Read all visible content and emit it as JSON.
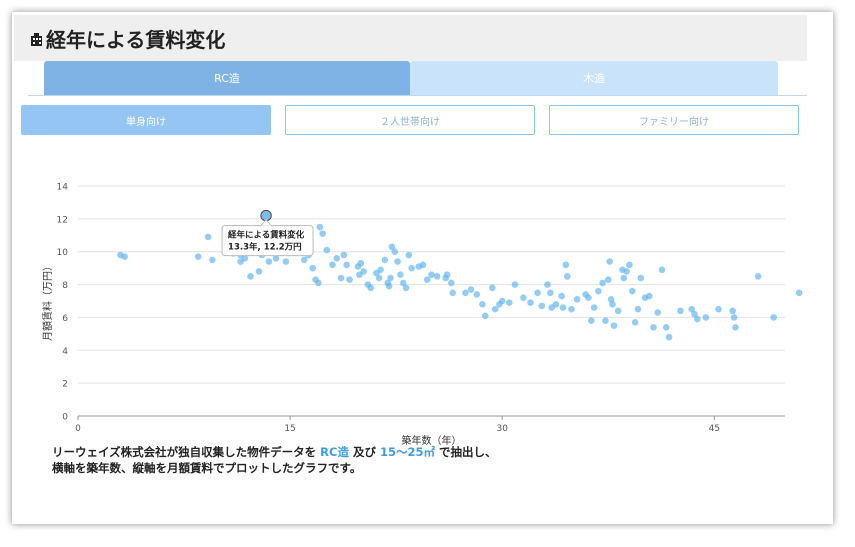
{
  "header": {
    "title": "経年による賃料変化",
    "icon": "building-icon"
  },
  "tabs": [
    {
      "label": "RC造",
      "active": true
    },
    {
      "label": "木造",
      "active": false
    }
  ],
  "segments": [
    {
      "label": "単身向け",
      "active": true
    },
    {
      "label": "２人世帯向け",
      "active": false
    },
    {
      "label": "ファミリー向け",
      "active": false
    }
  ],
  "tooltip": {
    "title": "経年による賃料変化",
    "value": "13.3年, 12.2万円"
  },
  "note": {
    "line1_a": "リーウェイズ株式会社が独自収集した物件データを",
    "line1_b": "RC造",
    "line1_c": "及び",
    "line1_d": "15〜25㎡",
    "line1_e": "で抽出し、",
    "line2": "横軸を築年数、縦軸を月額賃料でプロットしたグラフです。"
  },
  "colors": {
    "point": "#5ab2ee",
    "highlight": "#7cbcef",
    "accent": "#3d9ce8"
  },
  "chart_data": {
    "type": "scatter",
    "xlabel": "築年数（年）",
    "ylabel": "月額賃料（万円）",
    "xlim": [
      0,
      50
    ],
    "ylim": [
      0,
      14
    ],
    "xticks": [
      "0",
      "15",
      "30",
      "45"
    ],
    "yticks": [
      "0",
      "2",
      "4",
      "6",
      "8",
      "10",
      "12",
      "14"
    ],
    "highlight": [
      13.3,
      12.2
    ],
    "points": [
      [
        3,
        9.8
      ],
      [
        3.3,
        9.7
      ],
      [
        8.5,
        9.7
      ],
      [
        9.2,
        10.9
      ],
      [
        9.5,
        9.5
      ],
      [
        11,
        9.9
      ],
      [
        11.5,
        9.8
      ],
      [
        11.8,
        9.6
      ],
      [
        11.5,
        9.4
      ],
      [
        12.2,
        8.5
      ],
      [
        12.8,
        8.8
      ],
      [
        13,
        9.8
      ],
      [
        13.5,
        9.4
      ],
      [
        14,
        9.6
      ],
      [
        14.2,
        10.4
      ],
      [
        14.7,
        9.4
      ],
      [
        15.2,
        10.5
      ],
      [
        15.6,
        10.2
      ],
      [
        16,
        9.5
      ],
      [
        16.3,
        9.8
      ],
      [
        16.6,
        9
      ],
      [
        16.8,
        8.3
      ],
      [
        17,
        8.1
      ],
      [
        17.1,
        11.5
      ],
      [
        17.3,
        11.1
      ],
      [
        17.6,
        10.1
      ],
      [
        18,
        9.2
      ],
      [
        18.3,
        9.6
      ],
      [
        18.6,
        8.4
      ],
      [
        18.8,
        9.8
      ],
      [
        19,
        9.2
      ],
      [
        19.2,
        8.3
      ],
      [
        19.8,
        9.1
      ],
      [
        19.9,
        8.6
      ],
      [
        20,
        9.3
      ],
      [
        20.2,
        8.8
      ],
      [
        20.5,
        8
      ],
      [
        20.7,
        7.8
      ],
      [
        21.1,
        8.7
      ],
      [
        21.3,
        8.4
      ],
      [
        21.4,
        8.9
      ],
      [
        21.7,
        9.5
      ],
      [
        21.9,
        8.1
      ],
      [
        22,
        7.9
      ],
      [
        22.1,
        8.4
      ],
      [
        22.2,
        10.3
      ],
      [
        22.4,
        10
      ],
      [
        22.6,
        9.4
      ],
      [
        22.8,
        8.6
      ],
      [
        23,
        8.1
      ],
      [
        23.2,
        7.8
      ],
      [
        23.4,
        9.8
      ],
      [
        23.6,
        9
      ],
      [
        24.1,
        9.1
      ],
      [
        24.4,
        9.2
      ],
      [
        24.7,
        8.3
      ],
      [
        25,
        8.6
      ],
      [
        25.4,
        8.5
      ],
      [
        26,
        8.4
      ],
      [
        26.1,
        8.6
      ],
      [
        26.4,
        8.1
      ],
      [
        26.5,
        7.5
      ],
      [
        27.4,
        7.5
      ],
      [
        27.8,
        7.7
      ],
      [
        28.2,
        7.4
      ],
      [
        28.6,
        6.8
      ],
      [
        28.8,
        6.1
      ],
      [
        29.3,
        7.8
      ],
      [
        29.5,
        6.5
      ],
      [
        29.8,
        6.8
      ],
      [
        30,
        7
      ],
      [
        30.5,
        6.9
      ],
      [
        30.9,
        8
      ],
      [
        31.5,
        7.2
      ],
      [
        32,
        6.9
      ],
      [
        32.5,
        7.5
      ],
      [
        32.8,
        6.7
      ],
      [
        33.2,
        8
      ],
      [
        33.4,
        7.5
      ],
      [
        33.5,
        6.6
      ],
      [
        33.8,
        6.8
      ],
      [
        34.5,
        9.2
      ],
      [
        34.6,
        8.5
      ],
      [
        34.2,
        7.3
      ],
      [
        34.3,
        6.6
      ],
      [
        34.9,
        6.5
      ],
      [
        35.3,
        7.1
      ],
      [
        35.9,
        7.4
      ],
      [
        36.1,
        7.2
      ],
      [
        36.3,
        5.8
      ],
      [
        36.5,
        6.6
      ],
      [
        36.8,
        7.6
      ],
      [
        37.1,
        8.1
      ],
      [
        37.3,
        5.8
      ],
      [
        37.5,
        8.3
      ],
      [
        37.6,
        9.4
      ],
      [
        37.7,
        7.1
      ],
      [
        37.8,
        6.8
      ],
      [
        37.9,
        5.5
      ],
      [
        38.2,
        6.4
      ],
      [
        38.5,
        8.9
      ],
      [
        38.6,
        8.4
      ],
      [
        38.8,
        8.8
      ],
      [
        39,
        9.2
      ],
      [
        39.2,
        7.6
      ],
      [
        39.4,
        5.7
      ],
      [
        39.6,
        6.5
      ],
      [
        39.8,
        8.4
      ],
      [
        40.1,
        7.2
      ],
      [
        40.4,
        7.3
      ],
      [
        40.7,
        5.4
      ],
      [
        41,
        6.3
      ],
      [
        41.3,
        8.9
      ],
      [
        41.6,
        5.4
      ],
      [
        41.8,
        4.8
      ],
      [
        42.6,
        6.4
      ],
      [
        43.4,
        6.5
      ],
      [
        43.6,
        6.2
      ],
      [
        43.8,
        5.9
      ],
      [
        44.4,
        6
      ],
      [
        45.3,
        6.5
      ],
      [
        46.3,
        6.4
      ],
      [
        46.4,
        6
      ],
      [
        46.5,
        5.4
      ],
      [
        48.1,
        8.5
      ],
      [
        49.2,
        6
      ],
      [
        51,
        7.5
      ]
    ]
  }
}
